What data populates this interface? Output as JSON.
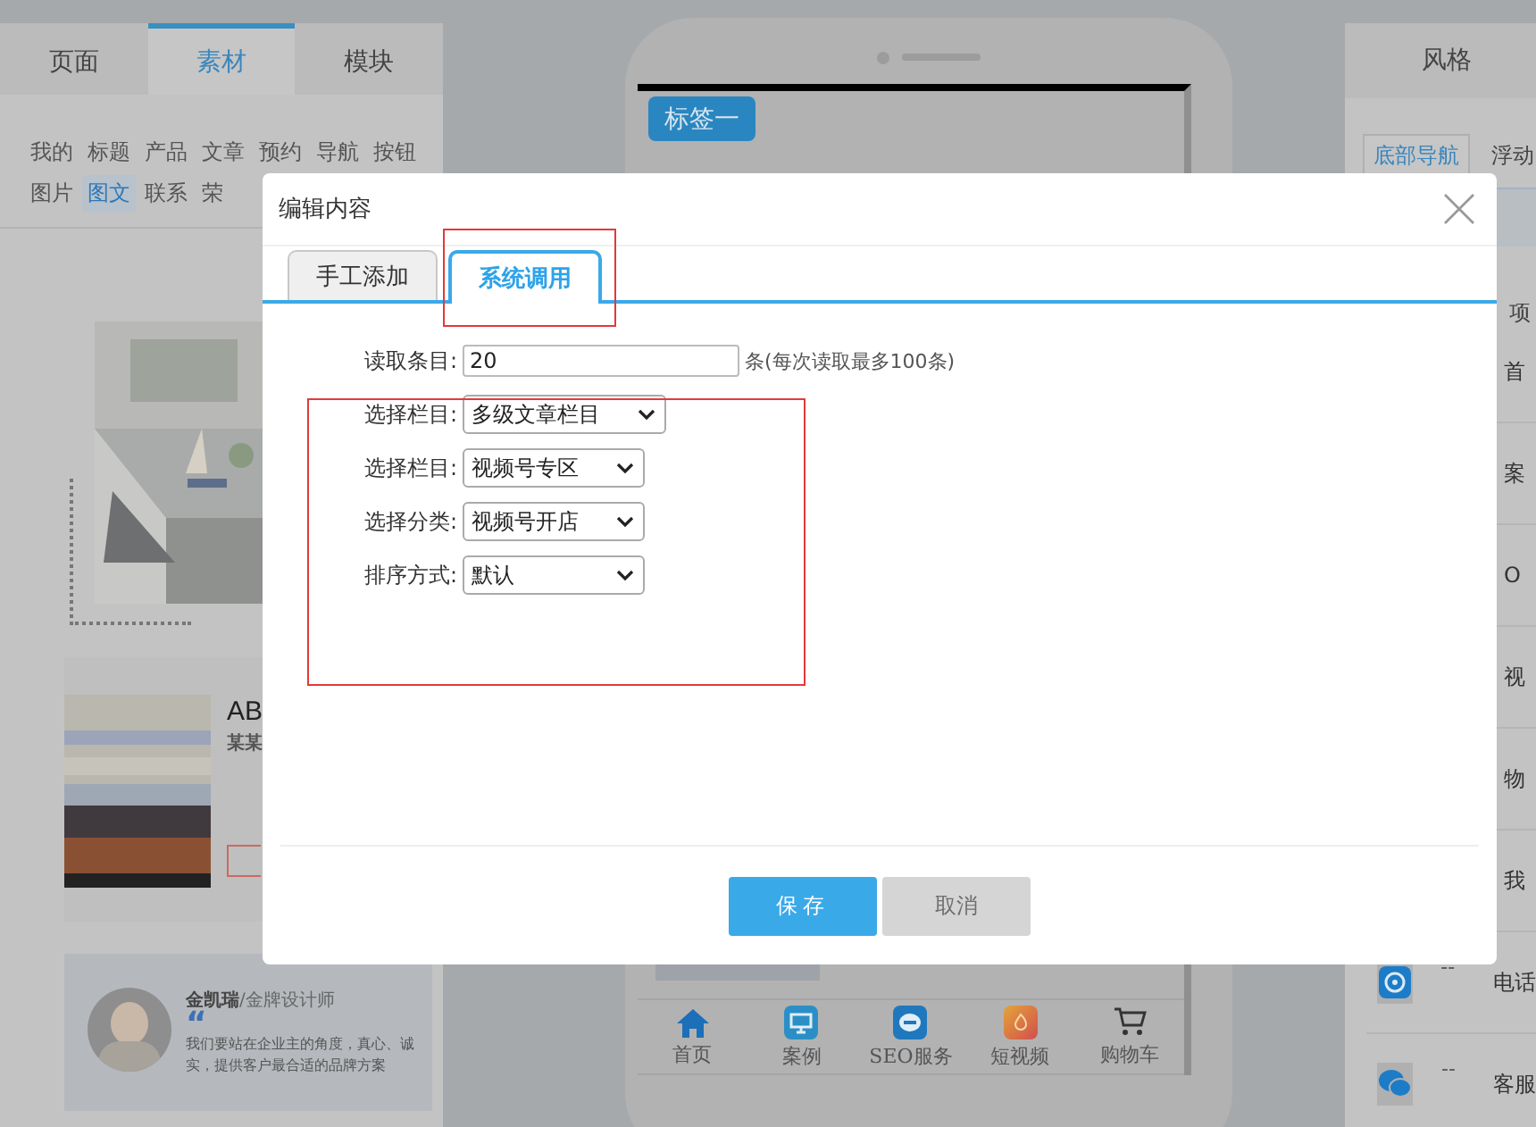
{
  "left_panel": {
    "tabs": [
      {
        "label": "页面",
        "selected": false
      },
      {
        "label": "素材",
        "selected": true
      },
      {
        "label": "模块",
        "selected": false
      }
    ],
    "category_rows": [
      [
        {
          "label": "我的",
          "selected": false
        },
        {
          "label": "标题",
          "selected": false
        },
        {
          "label": "产品",
          "selected": false
        },
        {
          "label": "文章",
          "selected": false
        },
        {
          "label": "预约",
          "selected": false
        },
        {
          "label": "导航",
          "selected": false
        },
        {
          "label": "按钮",
          "selected": false
        }
      ],
      [
        {
          "label": "图片",
          "selected": false
        },
        {
          "label": "图文",
          "selected": true
        },
        {
          "label": "联系",
          "selected": false
        },
        {
          "label": "荣",
          "selected": false
        }
      ]
    ],
    "article_card": {
      "title": "AB",
      "subtitle": "某某"
    },
    "testimonial": {
      "name": "金凯瑞",
      "role": "/金牌设计师",
      "quote_mark": "“",
      "text": "我们要站在企业主的角度，真心、诚实，提供客户最合适的品牌方案"
    }
  },
  "phone": {
    "tag_button": "标签一",
    "nav": [
      {
        "label": "首页",
        "kind": "home"
      },
      {
        "label": "案例",
        "kind": "monitor"
      },
      {
        "label": "SEO服务",
        "kind": "chat"
      },
      {
        "label": "短视频",
        "kind": "flame"
      },
      {
        "label": "购物车",
        "kind": "cart"
      }
    ]
  },
  "right_panel": {
    "title": "风格",
    "tabs": [
      {
        "label": "底部导航",
        "selected": true
      },
      {
        "label": "浮动",
        "selected": false
      }
    ],
    "column": "项",
    "items": [
      {
        "label": "首"
      },
      {
        "label": "案"
      },
      {
        "label": "O"
      },
      {
        "label": "视"
      },
      {
        "label": "物"
      },
      {
        "label": "我"
      },
      {
        "label": "电话",
        "value": "--",
        "kind": "phone"
      },
      {
        "label": "客服",
        "value": "--",
        "kind": "wechat"
      }
    ]
  },
  "dialog": {
    "title": "编辑内容",
    "tabs": [
      {
        "label": "手工添加",
        "selected": false
      },
      {
        "label": "系统调用",
        "selected": true
      }
    ],
    "fields": [
      {
        "label": "读取条目:",
        "kind": "input",
        "value": "20",
        "hint": "条(每次读取最多100条)"
      },
      {
        "label": "选择栏目:",
        "kind": "select",
        "value": "多级文章栏目",
        "wide": true
      },
      {
        "label": "选择栏目:",
        "kind": "select",
        "value": "视频号专区",
        "wide": false
      },
      {
        "label": "选择分类:",
        "kind": "select",
        "value": "视频号开店",
        "wide": false
      },
      {
        "label": "排序方式:",
        "kind": "select",
        "value": "默认",
        "wide": false
      }
    ],
    "buttons": [
      {
        "label": "保存",
        "kind": "primary"
      },
      {
        "label": "取消",
        "kind": "secondary"
      }
    ]
  }
}
